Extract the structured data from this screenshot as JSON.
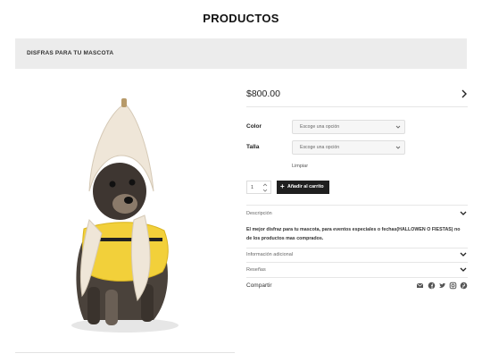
{
  "page": {
    "title": "PRODUCTOS"
  },
  "banner": {
    "label": "DISFRAS PARA TU MASCOTA"
  },
  "product": {
    "image_alt": "dog-in-banana-costume",
    "price": "$800.00",
    "attributes": [
      {
        "label": "Color",
        "placeholder": "Escoge una opción"
      },
      {
        "label": "Talla",
        "placeholder": "Escoge una opción"
      }
    ],
    "clear_label": "Limpiar",
    "quantity": "1",
    "add_to_cart": "Añadir al carrito",
    "description_text": "El mejor disfraz para tu mascota, para eventos especiales o fechas(HALLOWEN O FIESTAS) no de los productos mas comprados."
  },
  "accordion": {
    "description": "Descripción",
    "additional_info": "Información adicional",
    "reviews": "Reseñas"
  },
  "share": {
    "label": "Compartir",
    "icons": [
      "email-icon",
      "facebook-icon",
      "twitter-icon",
      "instagram-icon",
      "pinterest-icon"
    ]
  },
  "colors": {
    "button": "#1f1f1f",
    "banner": "#ececec",
    "costume_yellow": "#f2d03a"
  }
}
